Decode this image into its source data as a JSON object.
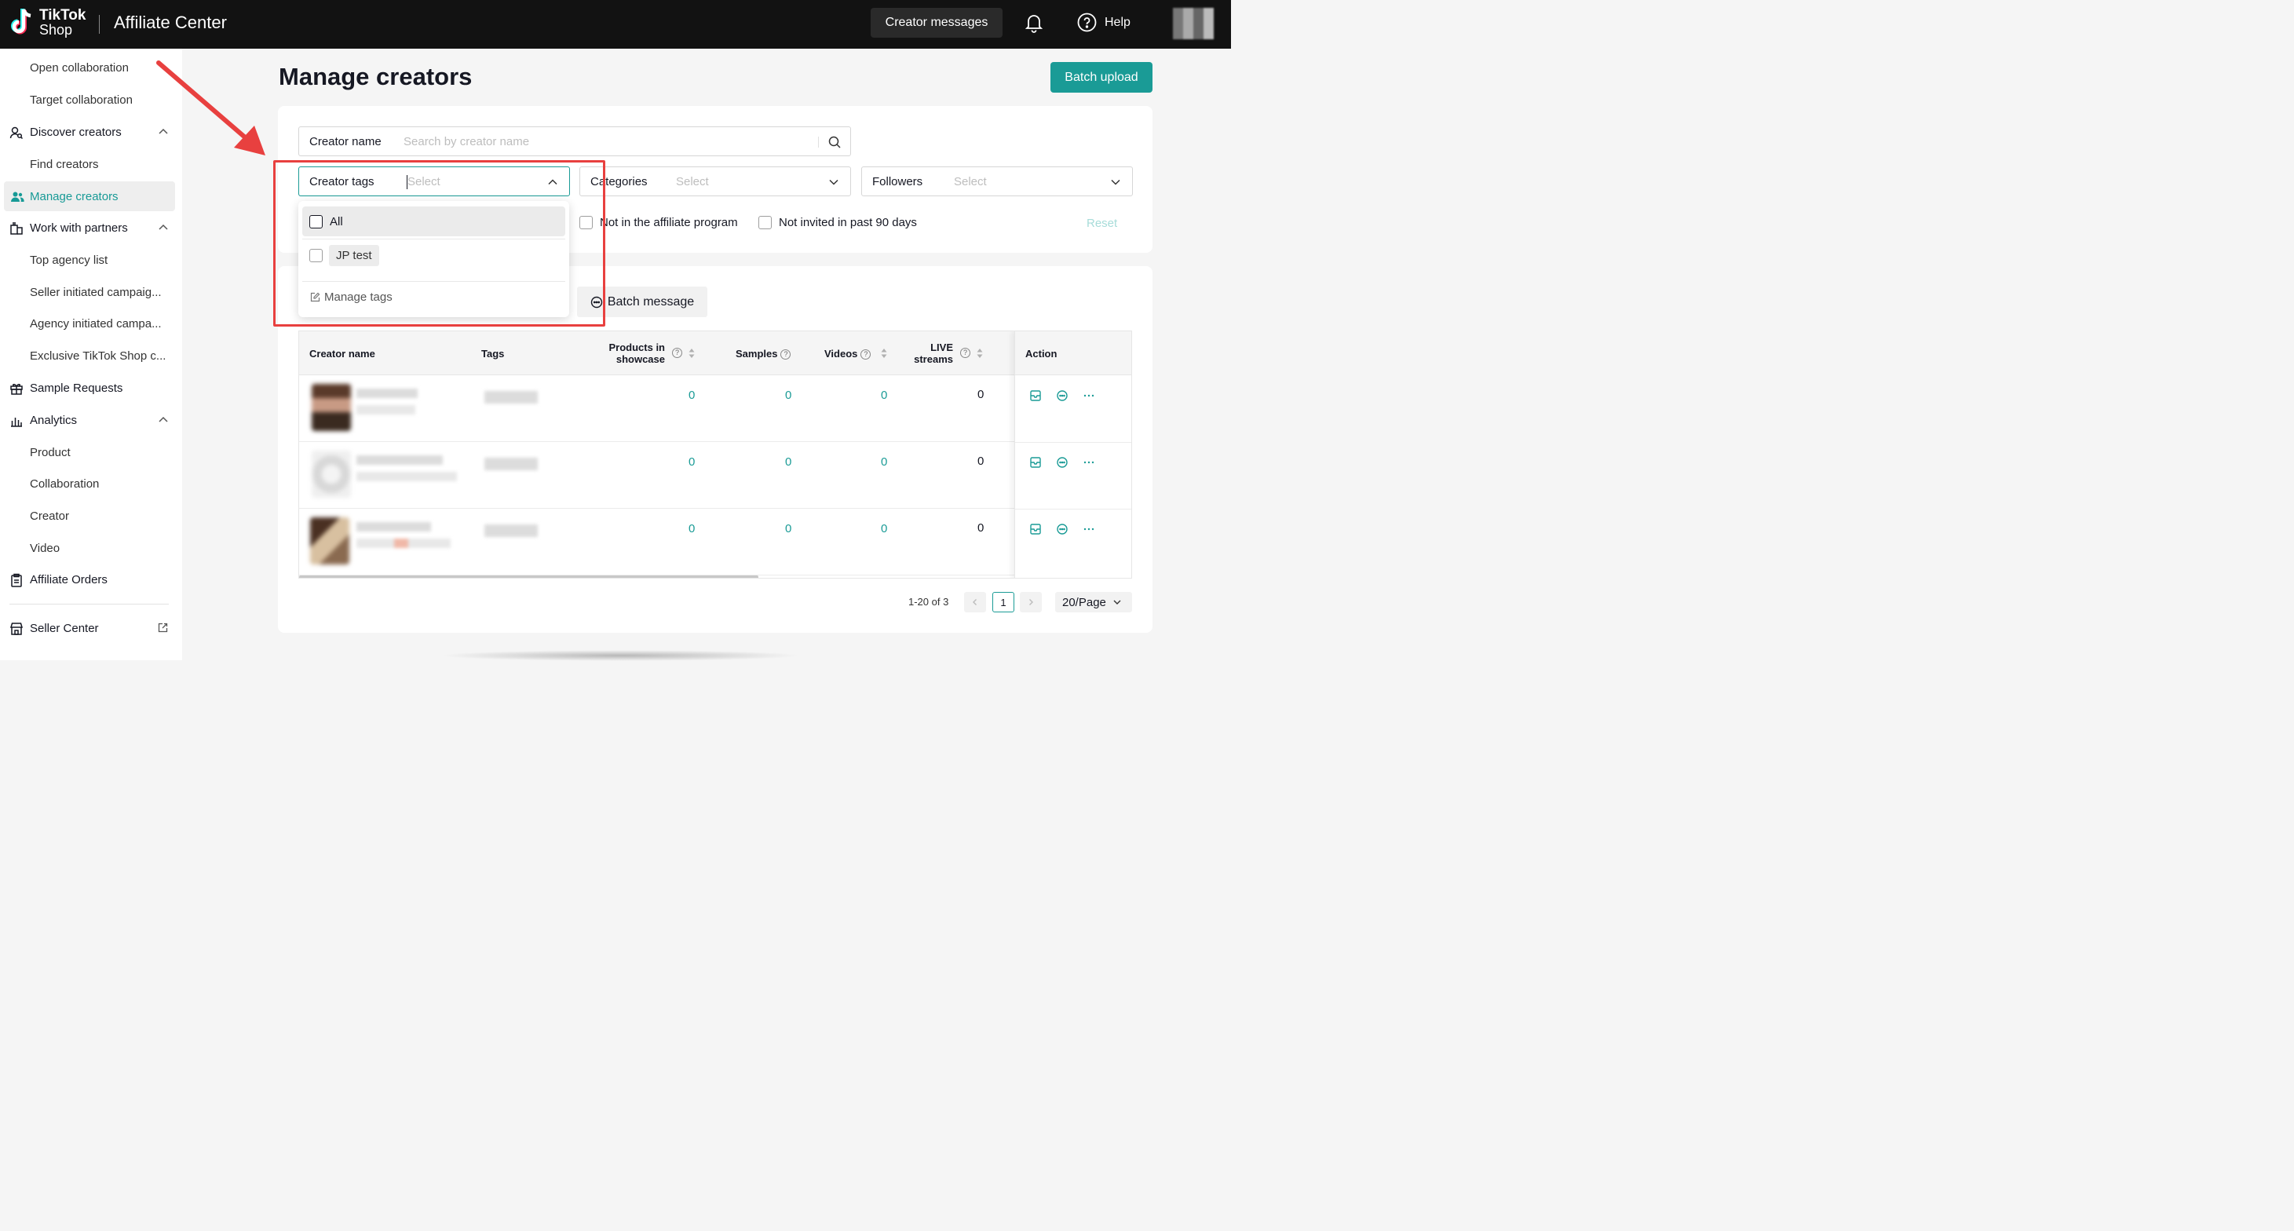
{
  "header": {
    "logo_line1": "TikTok",
    "logo_line2": "Shop",
    "app_title": "Affiliate Center",
    "creator_messages_label": "Creator messages",
    "help_label": "Help"
  },
  "sidebar": {
    "items": [
      {
        "label": "Open collaboration"
      },
      {
        "label": "Target collaboration"
      },
      {
        "label": "Discover creators"
      },
      {
        "label": "Find creators"
      },
      {
        "label": "Manage creators"
      },
      {
        "label": "Work with partners"
      },
      {
        "label": "Top agency list"
      },
      {
        "label": "Seller initiated campaig..."
      },
      {
        "label": "Agency initiated campa..."
      },
      {
        "label": "Exclusive TikTok Shop c..."
      },
      {
        "label": "Sample Requests"
      },
      {
        "label": "Analytics"
      },
      {
        "label": "Product"
      },
      {
        "label": "Collaboration"
      },
      {
        "label": "Creator"
      },
      {
        "label": "Video"
      },
      {
        "label": "Affiliate Orders"
      },
      {
        "label": "Seller Center"
      }
    ]
  },
  "main": {
    "page_title": "Manage creators",
    "batch_upload_label": "Batch upload",
    "filters": {
      "creator_name_label": "Creator name",
      "creator_name_placeholder": "Search by creator name",
      "creator_tags_label": "Creator tags",
      "creator_tags_placeholder": "Select",
      "categories_label": "Categories",
      "categories_placeholder": "Select",
      "followers_label": "Followers",
      "followers_placeholder": "Select",
      "not_in_program_label": "Not in the affiliate program",
      "not_invited_label": "Not invited in past 90 days",
      "reset_label": "Reset"
    },
    "dropdown": {
      "all_label": "All",
      "tag_option": "JP test",
      "manage_tags_label": "Manage tags"
    },
    "batch_message_label": "Batch message",
    "table": {
      "columns": {
        "creator_name": "Creator name",
        "tags": "Tags",
        "products_line1": "Products in",
        "products_line2": "showcase",
        "samples": "Samples",
        "videos": "Videos",
        "live_line1": "LIVE",
        "live_line2": "streams",
        "action": "Action"
      },
      "rows": [
        {
          "products": "0",
          "samples": "0",
          "videos": "0",
          "live": "0"
        },
        {
          "products": "0",
          "samples": "0",
          "videos": "0",
          "live": "0"
        },
        {
          "products": "0",
          "samples": "0",
          "videos": "0",
          "live": "0"
        }
      ]
    },
    "pagination": {
      "info": "1-20 of 3",
      "current_page": "1",
      "page_size": "20/Page"
    }
  },
  "colors": {
    "accent": "#1a9b96",
    "annotation": "#e8403f",
    "header_bg": "#121212"
  }
}
